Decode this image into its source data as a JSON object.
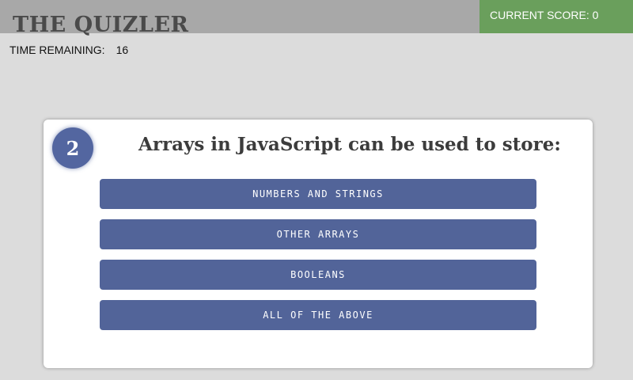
{
  "app": {
    "title": "THE QUIZLER"
  },
  "score": {
    "label": "CURRENT SCORE:",
    "value": "0"
  },
  "timer": {
    "label": "TIME REMAINING:",
    "value": "16"
  },
  "question": {
    "number": "2",
    "text": "Arrays in JavaScript can be used to store:",
    "answers": [
      {
        "label": "NUMBERS AND STRINGS"
      },
      {
        "label": "OTHER ARRAYS"
      },
      {
        "label": "BOOLEANS"
      },
      {
        "label": "ALL OF THE ABOVE"
      }
    ]
  },
  "colors": {
    "header": "#a8a8a8",
    "score_bg": "#6a9f5c",
    "accent": "#526499",
    "background": "#dcdcdc"
  }
}
